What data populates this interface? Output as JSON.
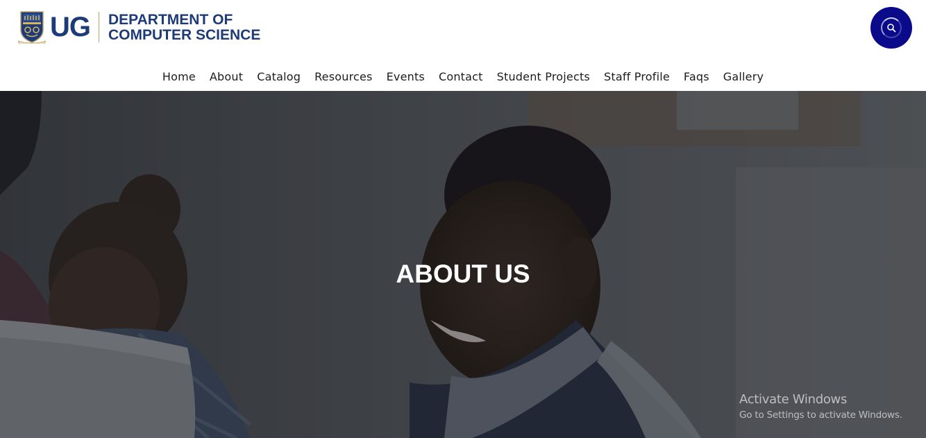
{
  "brand": {
    "short": "UG",
    "dept_line1": "DEPARTMENT OF",
    "dept_line2": "COMPUTER SCIENCE",
    "color": "#1d3b78"
  },
  "search": {
    "icon": "search-icon",
    "color": "#0a0a8a"
  },
  "nav": {
    "items": [
      {
        "label": "Home"
      },
      {
        "label": "About"
      },
      {
        "label": "Catalog"
      },
      {
        "label": "Resources"
      },
      {
        "label": "Events"
      },
      {
        "label": "Contact"
      },
      {
        "label": "Student Projects"
      },
      {
        "label": "Staff Profile"
      },
      {
        "label": "Faqs"
      },
      {
        "label": "Gallery"
      }
    ]
  },
  "hero": {
    "title": "ABOUT US"
  },
  "watermark": {
    "line1": "Activate Windows",
    "line2": "Go to Settings to activate Windows."
  }
}
